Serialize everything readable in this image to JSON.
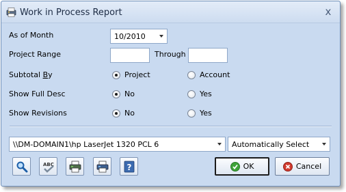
{
  "window": {
    "title": "Work in Process Report",
    "close_glyph": "x"
  },
  "form": {
    "as_of_month": {
      "label": "As of Month",
      "value": "10/2010"
    },
    "project_range": {
      "label": "Project Range",
      "from_value": "",
      "through_label": "Through",
      "through_value": ""
    },
    "subtotal_by": {
      "label": "Subtotal By",
      "options": [
        "Project",
        "Account"
      ],
      "selected": "Project"
    },
    "show_full_desc": {
      "label": "Show Full Desc",
      "options": [
        "No",
        "Yes"
      ],
      "selected": "No"
    },
    "show_revisions": {
      "label": "Show Revisions",
      "options": [
        "No",
        "Yes"
      ],
      "selected": "No"
    }
  },
  "printer": {
    "selected": "\\\\DM-DOMAIN1\\hp LaserJet 1320 PCL 6",
    "tray": "Automatically Select"
  },
  "toolbar": {
    "icons": [
      "preview-icon",
      "spell-check-icon",
      "print-icon",
      "print-setup-icon",
      "help-icon"
    ]
  },
  "buttons": {
    "ok": "OK",
    "cancel": "Cancel"
  },
  "colors": {
    "dialog_bg": "#c9daf0",
    "ok_green": "#3fa33a",
    "cancel_red": "#d13b2f"
  }
}
